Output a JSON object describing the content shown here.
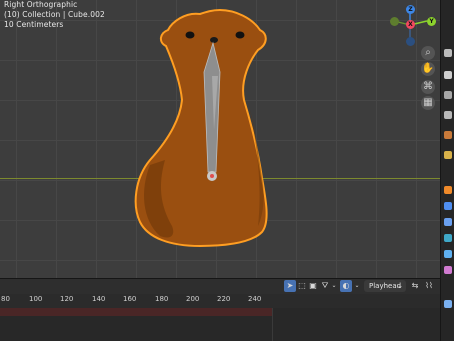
{
  "viewport": {
    "view_name": "Right Orthographic",
    "collection_info": "(10) Collection | Cube.002",
    "scale_label": "10 Centimeters"
  },
  "gizmo": {
    "axis_z": "Z",
    "axis_y": "Y",
    "axis_x": "X",
    "color_x": "#f3485f",
    "color_y": "#8cd32d",
    "color_z": "#3c86e6"
  },
  "object": {
    "name": "Cube.002",
    "body_color": "#9a4f10",
    "outline_color": "#ff9e22"
  },
  "tools": [
    "zoom-icon",
    "hand-pan-icon",
    "camera-icon",
    "grid-icon"
  ],
  "timeline": {
    "ticks": [
      "80",
      "100",
      "120",
      "140",
      "160",
      "180",
      "200",
      "220",
      "240"
    ],
    "playhead_label": "Playhead",
    "dropdown_arrow": "⌄"
  }
}
